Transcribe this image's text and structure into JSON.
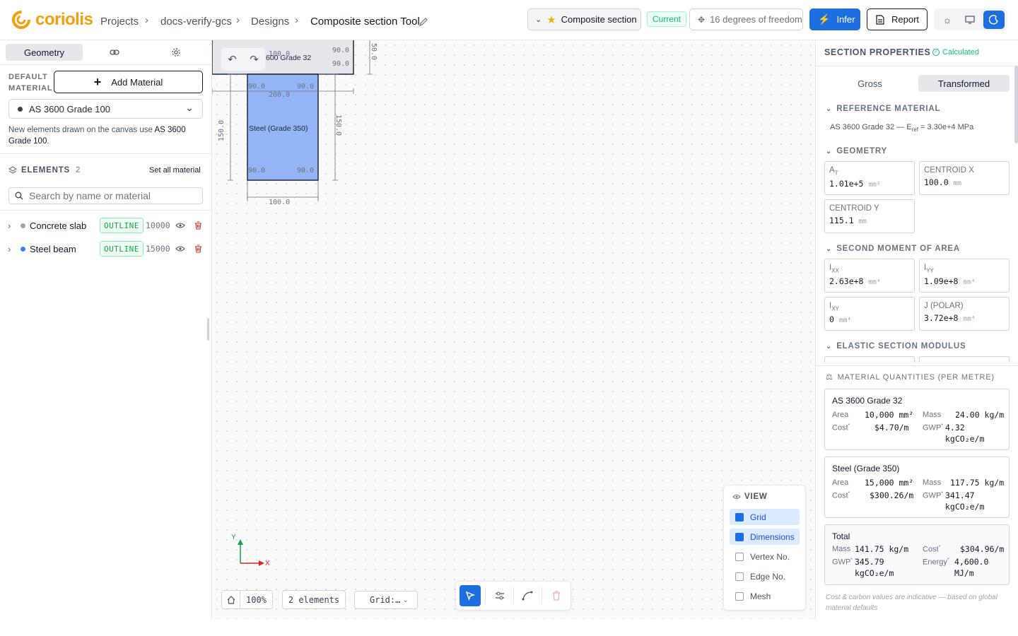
{
  "header": {
    "logo": "coriolis",
    "breadcrumbs": [
      "Projects",
      "docs-verify-gcs",
      "Designs"
    ],
    "title": "Composite section Tool",
    "version_select": "Composite section",
    "status_badge": "Current",
    "dof_button": "16 degrees of freedom",
    "infer_button": "Infer",
    "report_button": "Report",
    "theme_options": [
      "light",
      "system",
      "dark"
    ],
    "active_theme": "dark"
  },
  "left": {
    "tabs": [
      "Geometry",
      "link",
      "settings"
    ],
    "default_material_label": "DEFAULT MATERIAL",
    "add_material": "Add Material",
    "selected_material": "AS 3600 Grade 100",
    "note_prefix": "New elements drawn on the canvas use ",
    "note_material": "AS 3600 Grade 100",
    "note_suffix": ".",
    "elements_label": "ELEMENTS",
    "elements_count": "2",
    "set_all": "Set all material",
    "search_placeholder": "Search by name or material",
    "elements": [
      {
        "name": "Concrete slab",
        "badge": "OUTLINE",
        "value": "10000",
        "color": "#9ca3af"
      },
      {
        "name": "Steel beam",
        "badge": "OUTLINE",
        "value": "15000",
        "color": "#3b82f6"
      }
    ]
  },
  "canvas": {
    "slab_label": "600 Grade 32",
    "beam_label": "Steel (Grade 350)",
    "dim_slab_top": "100.0",
    "dim_slab_height": "50.0",
    "dim_beam_top": "200.0",
    "dim_beam_left": "150.0",
    "dim_beam_right": "150.0",
    "dim_beam_bottom": "100.0",
    "angle_label": "90.0",
    "axis_x": "X",
    "axis_y": "Y",
    "zoom": "100%",
    "elements_count": "2 elements",
    "grid_select": "Grid:…",
    "view": {
      "title": "VIEW",
      "items": [
        {
          "label": "Grid",
          "checked": true
        },
        {
          "label": "Dimensions",
          "checked": true
        },
        {
          "label": "Vertex No.",
          "checked": false
        },
        {
          "label": "Edge No.",
          "checked": false
        },
        {
          "label": "Mesh",
          "checked": false
        }
      ]
    }
  },
  "right": {
    "title": "SECTION PROPERTIES",
    "status": "Calculated",
    "toggle": [
      "Gross",
      "Transformed"
    ],
    "active_toggle": "Transformed",
    "reference_header": "REFERENCE MATERIAL",
    "reference_text": "AS 3600 Grade 32 — E",
    "reference_sub": "ref",
    "reference_value": " = 3.30e+4 MPa",
    "geometry_header": "GEOMETRY",
    "geometry": [
      {
        "label": "A",
        "sub": "T",
        "value": "1.01e+5",
        "unit": "mm²"
      },
      {
        "label": "CENTROID X",
        "sub": "",
        "value": "100.0",
        "unit": "mm"
      },
      {
        "label": "CENTROID Y",
        "sub": "",
        "value": "115.1",
        "unit": "mm"
      }
    ],
    "moment_header": "SECOND MOMENT OF AREA",
    "moments": [
      {
        "label": "I",
        "sub": "XX",
        "value": "2.63e+8",
        "unit": "mm⁴"
      },
      {
        "label": "I",
        "sub": "YY",
        "value": "1.09e+8",
        "unit": "mm⁴"
      },
      {
        "label": "I",
        "sub": "XY",
        "value": "0",
        "unit": "mm⁴"
      },
      {
        "label": "J (POLAR)",
        "sub": "",
        "value": "3.72e+8",
        "unit": "mm⁴"
      }
    ],
    "elastic_header": "ELASTIC SECTION MODULUS",
    "quantities_header": "MATERIAL QUANTITIES (PER METRE)",
    "quantities": [
      {
        "name": "AS 3600 Grade 32",
        "area": "10,000 mm²",
        "mass": "24.00 kg/m",
        "cost": "$4.70/m",
        "gwp": "4.32",
        "gwp_unit": "kgCO₂e/m"
      },
      {
        "name": "Steel (Grade 350)",
        "area": "15,000 mm²",
        "mass": "117.75 kg/m",
        "cost": "$300.26/m",
        "gwp": "341.47",
        "gwp_unit": "kgCO₂e/m"
      }
    ],
    "total": {
      "name": "Total",
      "mass": "141.75 kg/m",
      "cost": "$304.96/m",
      "gwp": "345.79",
      "gwp_unit": "kgCO₂e/m",
      "energy": "4,600.0",
      "energy_unit": "MJ/m"
    },
    "labels": {
      "area": "Area",
      "mass": "Mass",
      "cost": "Cost",
      "gwp": "GWP",
      "energy": "Energy"
    },
    "footnote": "Cost & carbon values are indicative — based on global material defaults"
  }
}
